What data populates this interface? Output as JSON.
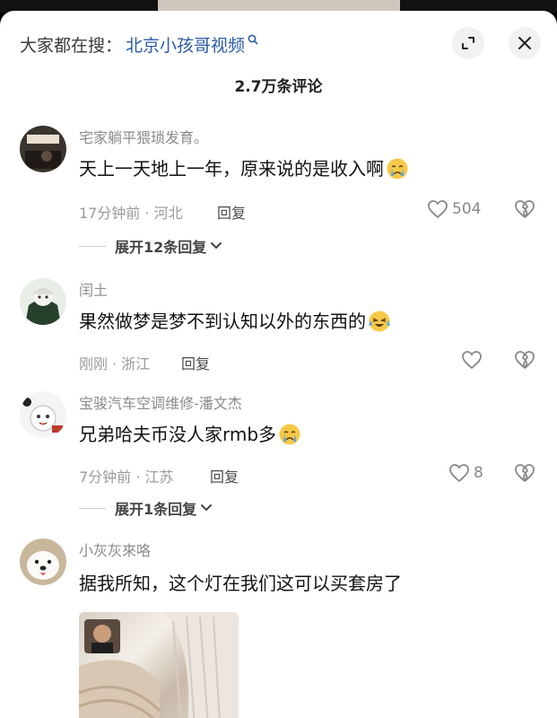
{
  "search": {
    "prefix": "大家都在搜：",
    "query": "北京小孩哥视频"
  },
  "header": {
    "comment_count": "2.7万条评论"
  },
  "comments": [
    {
      "user": "宅家躺平猥琐发育。",
      "text": "天上一天地上一年，原来说的是收入啊",
      "emoji": "crying-emoji",
      "meta": "17分钟前 · 河北",
      "reply_label": "回复",
      "likes": "504",
      "expand_label": "展开12条回复"
    },
    {
      "user": "闰土",
      "text": "果然做梦是梦不到认知以外的东西的",
      "emoji": "crying-laughing-emoji",
      "meta": "刚刚 · 浙江",
      "reply_label": "回复",
      "likes": ""
    },
    {
      "user": "宝骏汽车空调维修-潘文杰",
      "text": "兄弟哈夫币没人家rmb多",
      "emoji": "crying-emoji",
      "meta": "7分钟前 · 江苏",
      "reply_label": "回复",
      "likes": "8",
      "expand_label": "展开1条回复"
    },
    {
      "user": "小灰灰來咯",
      "text": "据我所知，这个灯在我们这可以买套房了"
    }
  ],
  "colors": {
    "link": "#2b5ba8",
    "muted": "#9a9a9a",
    "emoji_face": "#f7c948",
    "emoji_tear": "#4aa3f0"
  }
}
